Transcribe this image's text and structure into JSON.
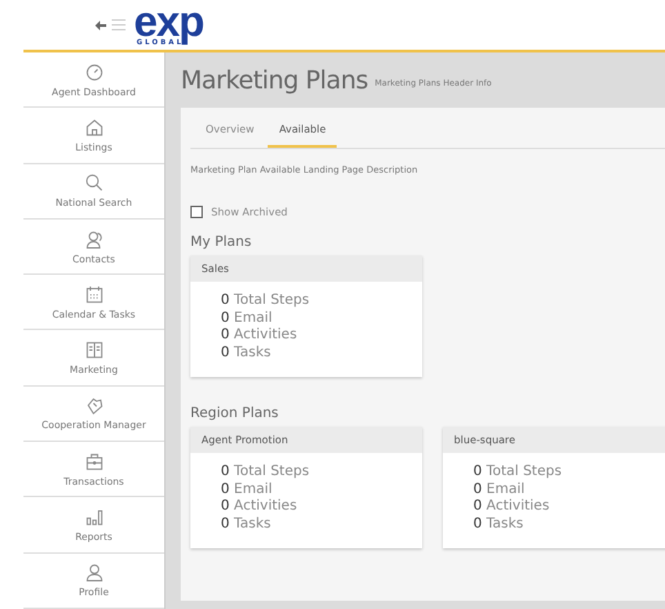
{
  "header": {
    "logo": "exp",
    "logo_sub": "GLOBAL"
  },
  "sidebar": {
    "items": [
      {
        "label": "Agent Dashboard"
      },
      {
        "label": "Listings"
      },
      {
        "label": "National Search"
      },
      {
        "label": "Contacts"
      },
      {
        "label": "Calendar & Tasks"
      },
      {
        "label": "Marketing"
      },
      {
        "label": "Cooperation Manager"
      },
      {
        "label": "Transactions"
      },
      {
        "label": "Reports"
      },
      {
        "label": "Profile"
      }
    ]
  },
  "page": {
    "title": "Marketing Plans",
    "subtitle": "Marketing Plans Header Info"
  },
  "tabs": [
    {
      "label": "Overview",
      "selected": false
    },
    {
      "label": "Available",
      "selected": true
    }
  ],
  "description": "Marketing Plan Available Landing Page Description",
  "show_archived": {
    "label": "Show Archived",
    "checked": false
  },
  "sections": [
    {
      "title": "My Plans",
      "plans": [
        {
          "name": "Sales",
          "stats": [
            "**0** Total Steps",
            "**0** Email",
            "**0** Activities",
            "**0** Tasks"
          ]
        }
      ]
    },
    {
      "title": "Region Plans",
      "plans": [
        {
          "name": "Agent Promotion",
          "stats": [
            "**0** Total Steps",
            "**0** Email",
            "**0** Activities",
            "**0** Tasks"
          ]
        },
        {
          "name": "blue-square",
          "stats": [
            "**0** Total Steps",
            "**0** Email",
            "**0** Activities",
            "**0** Tasks"
          ]
        }
      ]
    }
  ]
}
